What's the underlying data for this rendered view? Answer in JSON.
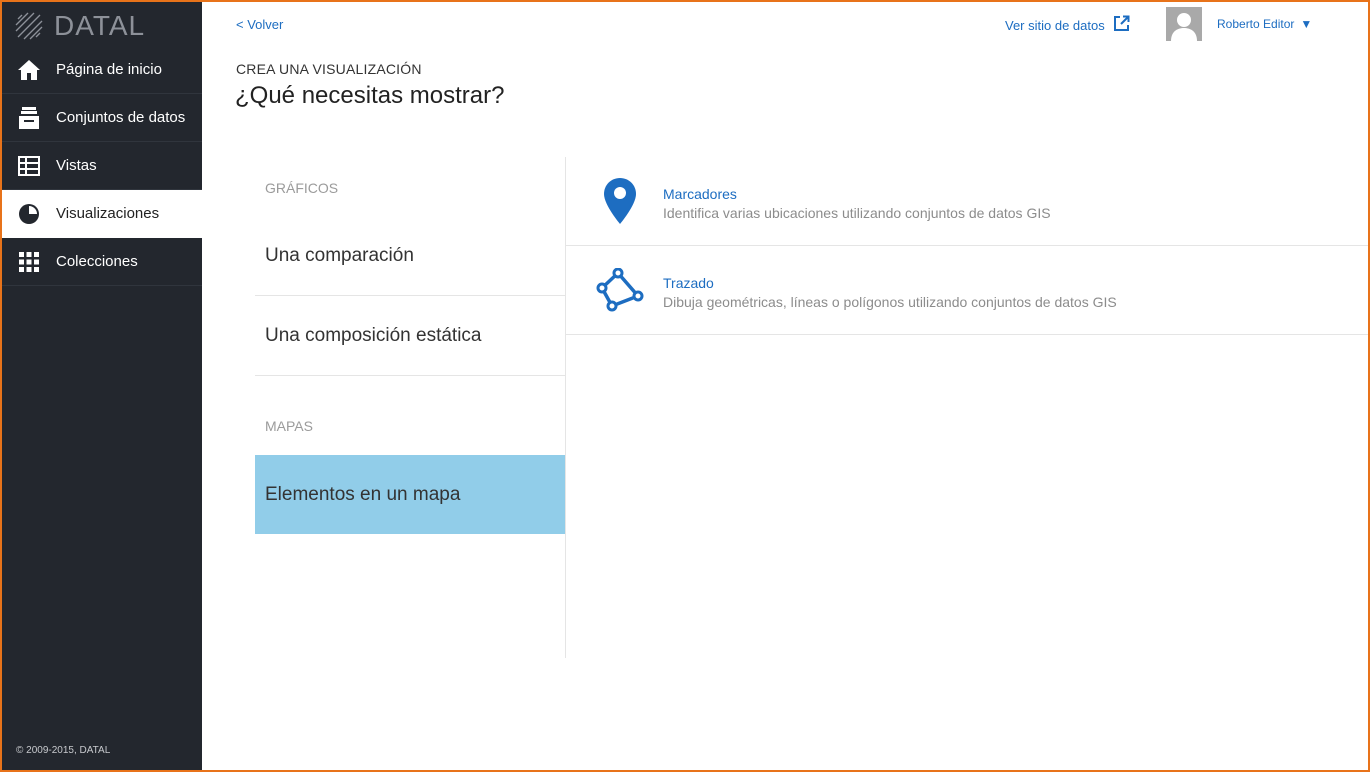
{
  "brand": {
    "name": "DATAL",
    "copyright": "© 2009-2015, DATAL"
  },
  "sidebar": {
    "items": [
      {
        "label": "Página de inicio",
        "icon": "home-icon"
      },
      {
        "label": "Conjuntos de datos",
        "icon": "inbox-icon"
      },
      {
        "label": "Vistas",
        "icon": "table-icon"
      },
      {
        "label": "Visualizaciones",
        "icon": "pie-chart-icon",
        "active": true
      },
      {
        "label": "Colecciones",
        "icon": "grid-icon"
      }
    ]
  },
  "topbar": {
    "back": "< Volver",
    "site_link": "Ver sitio de datos",
    "user": "Roberto Editor",
    "user_caret": "▼"
  },
  "header": {
    "kicker": "CREA UNA VISUALIZACIÓN",
    "title": "¿Qué necesitas mostrar?"
  },
  "categories": {
    "charts_heading": "GRÁFICOS",
    "charts": [
      "Una comparación",
      "Una composición estática"
    ],
    "maps_heading": "MAPAS",
    "maps": [
      "Elementos en un mapa"
    ]
  },
  "options": [
    {
      "title": "Marcadores",
      "description": "Identifica varias ubicaciones utilizando conjuntos de datos GIS",
      "icon": "map-pin-icon"
    },
    {
      "title": "Trazado",
      "description": "Dibuja geométricas, líneas o polígonos utilizando conjuntos de datos GIS",
      "icon": "polygon-icon"
    }
  ],
  "colors": {
    "accent": "#1d6dc1",
    "active_category": "#91cde9",
    "sidebar": "#23272e",
    "frame": "#e8731a"
  }
}
